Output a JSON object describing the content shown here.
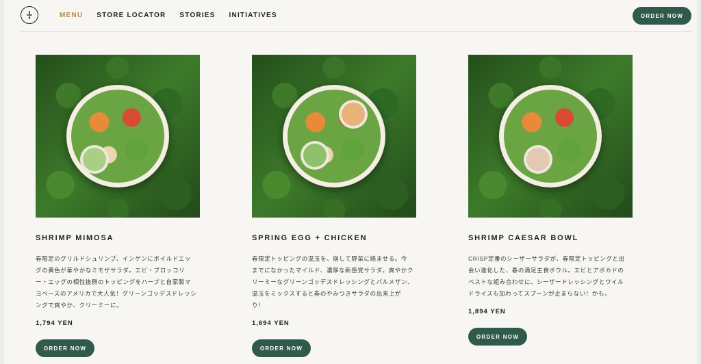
{
  "header": {
    "nav": [
      "MENU",
      "STORE LOCATOR",
      "STORIES",
      "INITIATIVES"
    ],
    "order_now": "ORDER NOW",
    "accent_color": "#b08a4b",
    "button_color": "#2f5a4c"
  },
  "products": [
    {
      "name": "SHRIMP MIMOSA",
      "description": "春限定のグリルドシュリンプ、インゲンにボイルドエッグの黄色が華やかなミモザサラダ。エビ・ブロッコリー・エッグの相性抜群のトッピングをハーブと自家製マヨベースのアメリカで大人気！グリーンゴッデスドレッシングで爽やか、クリーミーに。",
      "price": "1,794 YEN",
      "button": "ORDER NOW"
    },
    {
      "name": "SPRING EGG + CHICKEN",
      "description": "春限定トッピングの温玉を、崩して野菜に絡ませる。今までになかったマイルド、濃厚な新感覚サラダ。爽やかクリーミーなグリーンゴッデスドレッシングとバルメザン、温玉をミックスすると春のやみつきサラダの出来上がり！",
      "price": "1,694 YEN",
      "button": "ORDER NOW"
    },
    {
      "name": "SHRIMP CAESAR BOWL",
      "description": "CRISP定番のシーザーサラダが、春限定トッピングと出会い進化した、春の満足主食ボウル。エビとアボカドのベストな組み合わせに、シーザードレッシングとワイルドライスも加わってスプーンが止まらない！かも。",
      "price": "1,894 YEN",
      "button": "ORDER NOW"
    }
  ]
}
